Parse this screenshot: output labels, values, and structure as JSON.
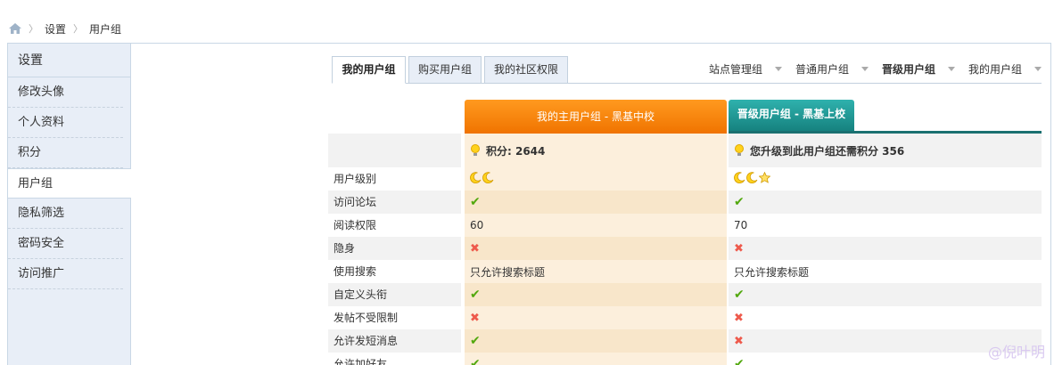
{
  "breadcrumb": {
    "items": [
      "设置",
      "用户组"
    ],
    "separator": "〉"
  },
  "sidebar": {
    "title": "设置",
    "items": [
      {
        "label": "修改头像"
      },
      {
        "label": "个人资料"
      },
      {
        "label": "积分"
      },
      {
        "label": "用户组",
        "active": true
      },
      {
        "label": "隐私筛选"
      },
      {
        "label": "密码安全"
      },
      {
        "label": "访问推广"
      }
    ]
  },
  "tabs": {
    "items": [
      "我的用户组",
      "购买用户组",
      "我的社区权限"
    ],
    "active": 0,
    "links": [
      {
        "label": "站点管理组",
        "bold": false
      },
      {
        "label": "普通用户组",
        "bold": false
      },
      {
        "label": "晋级用户组",
        "bold": true
      },
      {
        "label": "我的用户组",
        "bold": false
      }
    ]
  },
  "columns": {
    "main": "我的主用户组 - 黑基中校",
    "next": "晋级用户组 - 黑基上校"
  },
  "summary": {
    "main": "积分: 2644",
    "next": "您升级到此用户组还需积分 356"
  },
  "rows": [
    {
      "label": "用户级别",
      "main": {
        "type": "level",
        "icons": [
          "moon",
          "moon"
        ]
      },
      "next": {
        "type": "level",
        "icons": [
          "moon",
          "moon",
          "star"
        ]
      }
    },
    {
      "label": "访问论坛",
      "main": {
        "type": "ok"
      },
      "next": {
        "type": "ok"
      }
    },
    {
      "label": "阅读权限",
      "main": {
        "type": "text",
        "value": "60"
      },
      "next": {
        "type": "text",
        "value": "70"
      }
    },
    {
      "label": "隐身",
      "main": {
        "type": "no"
      },
      "next": {
        "type": "no"
      }
    },
    {
      "label": "使用搜索",
      "main": {
        "type": "text",
        "value": "只允许搜索标题"
      },
      "next": {
        "type": "text",
        "value": "只允许搜索标题"
      }
    },
    {
      "label": "自定义头衔",
      "main": {
        "type": "ok"
      },
      "next": {
        "type": "ok"
      }
    },
    {
      "label": "发帖不受限制",
      "main": {
        "type": "no"
      },
      "next": {
        "type": "no"
      }
    },
    {
      "label": "允许发短消息",
      "main": {
        "type": "ok"
      },
      "next": {
        "type": "no"
      }
    },
    {
      "label": "允许加好友",
      "main": {
        "type": "ok"
      },
      "next": {
        "type": "ok"
      }
    }
  ],
  "icons": {
    "home": "home-icon",
    "bulb": "lightbulb-icon",
    "ok": "check-icon",
    "no": "cross-icon",
    "moon": "moon-icon",
    "star": "star-icon",
    "dropdown": "chevron-down-icon"
  },
  "glyphs": {
    "ok": "✔",
    "no": "✖"
  },
  "colors": {
    "main_header": "#f07300",
    "next_header": "#16827f",
    "main_bg": "#fcefdc",
    "ok": "#52a80e",
    "no": "#ee5a4c"
  },
  "watermark": "@倪叶明"
}
